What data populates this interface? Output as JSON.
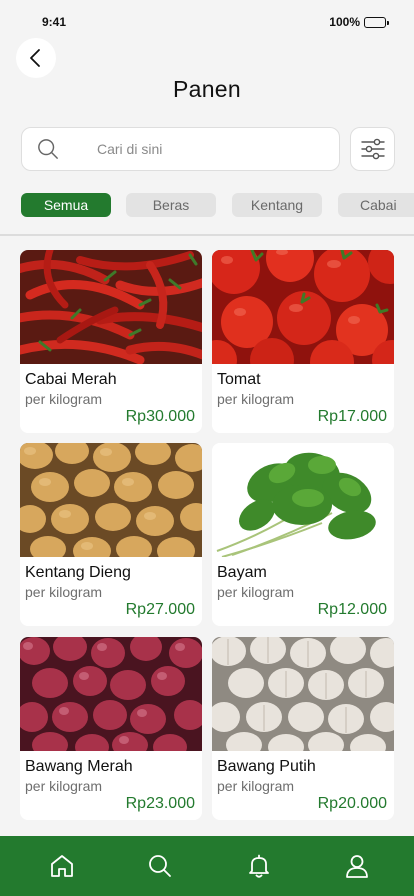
{
  "status": {
    "time": "9:41",
    "battery": "100%"
  },
  "header": {
    "title": "Panen",
    "back_icon": "chevron-left-icon"
  },
  "search": {
    "placeholder": "Cari di sini",
    "icon": "search-icon",
    "filter_icon": "sliders-icon"
  },
  "categories": [
    {
      "label": "Semua",
      "active": true
    },
    {
      "label": "Beras",
      "active": false
    },
    {
      "label": "Kentang",
      "active": false
    },
    {
      "label": "Cabai",
      "active": false
    }
  ],
  "products": [
    {
      "name": "Cabai Merah",
      "unit": "per kilogram",
      "price": "Rp30.000"
    },
    {
      "name": "Tomat",
      "unit": "per kilogram",
      "price": "Rp17.000"
    },
    {
      "name": "Kentang Dieng",
      "unit": "per kilogram",
      "price": "Rp27.000"
    },
    {
      "name": "Bayam",
      "unit": "per kilogram",
      "price": "Rp12.000"
    },
    {
      "name": "Bawang Merah",
      "unit": "per kilogram",
      "price": "Rp23.000"
    },
    {
      "name": "Bawang Putih",
      "unit": "per kilogram",
      "price": "Rp20.000"
    }
  ],
  "bottom_nav": [
    {
      "icon": "home-icon"
    },
    {
      "icon": "search-icon"
    },
    {
      "icon": "bell-icon"
    },
    {
      "icon": "profile-icon"
    }
  ],
  "colors": {
    "brand": "#237a2e",
    "background": "#f4f4f4"
  }
}
